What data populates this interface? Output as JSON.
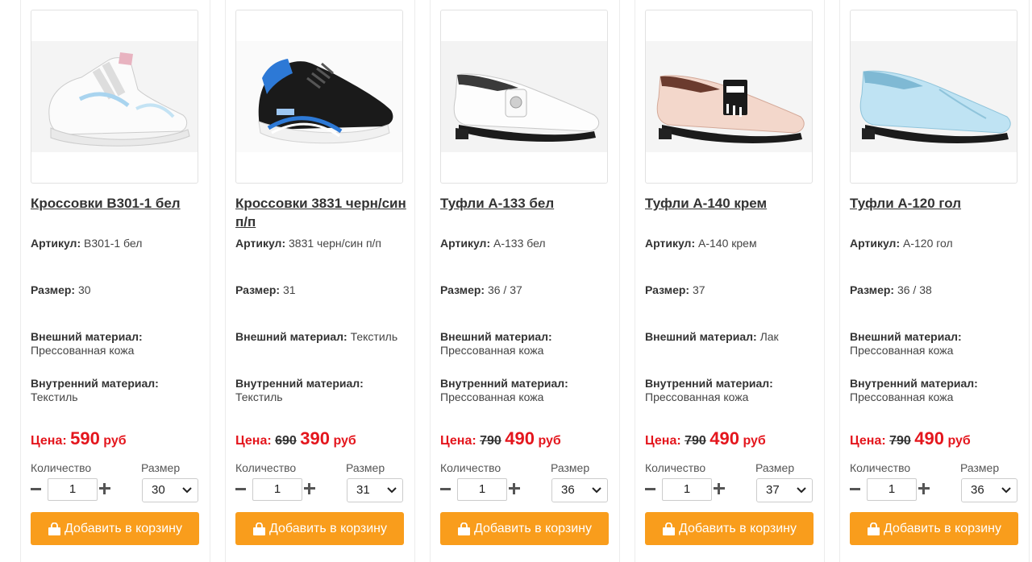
{
  "labels": {
    "article": "Артикул:",
    "size": "Размер:",
    "outer_material": "Внешний материал:",
    "inner_material": "Внутренний материал:",
    "price": "Цена:",
    "currency": "руб",
    "quantity": "Количество",
    "size_select": "Размер",
    "add_to_cart": "Добавить в корзину",
    "minus_icon": "minus-icon",
    "plus_icon": "plus-icon",
    "cart_icon": "shopping-bag-icon",
    "chevron_icon": "chevron-down-icon"
  },
  "colors": {
    "accent": "#f99d1c",
    "price": "#e4161d"
  },
  "products": [
    {
      "title": "Кроссовки B301-1 бел",
      "article": "B301-1 бел",
      "size": "30",
      "outer_material": "Прессованная кожа",
      "inner_material": "Текстиль",
      "old_price": "",
      "price": "590",
      "quantity": "1",
      "selected_size": "30"
    },
    {
      "title": "Кроссовки 3831 черн/син п/п",
      "article": "3831 черн/син п/п",
      "size": "31",
      "outer_material": "Текстиль",
      "inner_material": "Текстиль",
      "old_price": "690",
      "price": "390",
      "quantity": "1",
      "selected_size": "31"
    },
    {
      "title": "Туфли A-133 бел",
      "article": "A-133 бел",
      "size": "36 / 37",
      "outer_material": "Прессованная кожа",
      "inner_material": "Прессованная кожа",
      "old_price": "790",
      "price": "490",
      "quantity": "1",
      "selected_size": "36"
    },
    {
      "title": "Туфли A-140 крем",
      "article": "A-140 крем",
      "size": "37",
      "outer_material": "Лак",
      "inner_material": "Прессованная кожа",
      "old_price": "790",
      "price": "490",
      "quantity": "1",
      "selected_size": "37"
    },
    {
      "title": "Туфли A-120 гол",
      "article": "A-120 гол",
      "size": "36 / 38",
      "outer_material": "Прессованная кожа",
      "inner_material": "Прессованная кожа",
      "old_price": "790",
      "price": "490",
      "quantity": "1",
      "selected_size": "36"
    }
  ]
}
